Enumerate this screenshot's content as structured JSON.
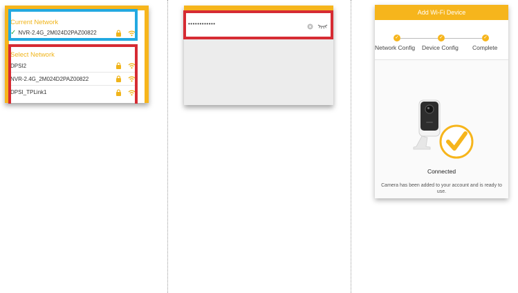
{
  "colors": {
    "accent": "#f6b51c",
    "highlight_blue": "#23a9e1",
    "highlight_red": "#d62b33",
    "check_green": "#29a84a"
  },
  "panel1": {
    "current_title": "Current Network",
    "current_network": {
      "name": "NVR-2.4G_2M024D2PAZ00822",
      "icons": [
        "check-icon",
        "lock-icon",
        "wifi-icon"
      ]
    },
    "select_title": "Select Network",
    "networks": [
      {
        "name": "DPSI2",
        "icons": [
          "lock-icon",
          "wifi-icon"
        ]
      },
      {
        "name": "NVR-2.4G_2M024D2PAZ00822",
        "icons": [
          "lock-icon",
          "wifi-icon"
        ]
      },
      {
        "name": "DPSI_TPLink1",
        "icons": [
          "lock-icon",
          "wifi-icon"
        ]
      }
    ]
  },
  "panel2": {
    "password_masked": "••••••••••••",
    "icons": [
      "clear-icon",
      "eye-hidden-icon"
    ]
  },
  "panel3": {
    "header": "Add Wi-Fi Device",
    "steps": [
      {
        "label": "Network Config",
        "status": "done"
      },
      {
        "label": "Device Config",
        "status": "done"
      },
      {
        "label": "Complete",
        "status": "done"
      }
    ],
    "status_title": "Connected",
    "status_desc": "Camera has been added to your account and is ready to use."
  }
}
